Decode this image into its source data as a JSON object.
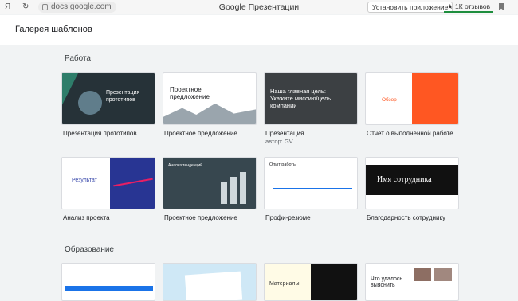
{
  "browser": {
    "ya": "Я",
    "reload": "↻",
    "url": "docs.google.com",
    "title": "Google Презентации",
    "install": "Установить приложение",
    "reviews": "★ 1К отзывов"
  },
  "gallery": {
    "title": "Галерея шаблонов"
  },
  "sections": {
    "work": {
      "title": "Работа",
      "cards": [
        {
          "label": "Презентация прототипов",
          "thumb_title": "Презентация прототипов"
        },
        {
          "label": "Проектное предложение",
          "thumb_title": "Проектное предложение"
        },
        {
          "label": "Презентация",
          "sub": "автор: GV",
          "thumb_title": "Наша главная цель: Укажите миссию/цель компании"
        },
        {
          "label": "Отчет о выполненной работе",
          "thumb_title": "Обзор"
        },
        {
          "label": "Анализ проекта",
          "thumb_title": "Результат"
        },
        {
          "label": "Проектное предложение",
          "thumb_title": "Анализ тенденций"
        },
        {
          "label": "Профи-резюме",
          "thumb_title": "Опыт работы"
        },
        {
          "label": "Благодарность сотруднику",
          "thumb_title": "Имя сотрудника"
        }
      ]
    },
    "education": {
      "title": "Образование",
      "cards": [
        {
          "label": ""
        },
        {
          "label": ""
        },
        {
          "thumb_title": "Материалы"
        },
        {
          "thumb_title": "Что удалось выяснить"
        }
      ]
    }
  },
  "colors": {
    "accent_orange": "#ff5722",
    "dark_slate": "#263238",
    "brand_blue": "#1a73e8"
  }
}
